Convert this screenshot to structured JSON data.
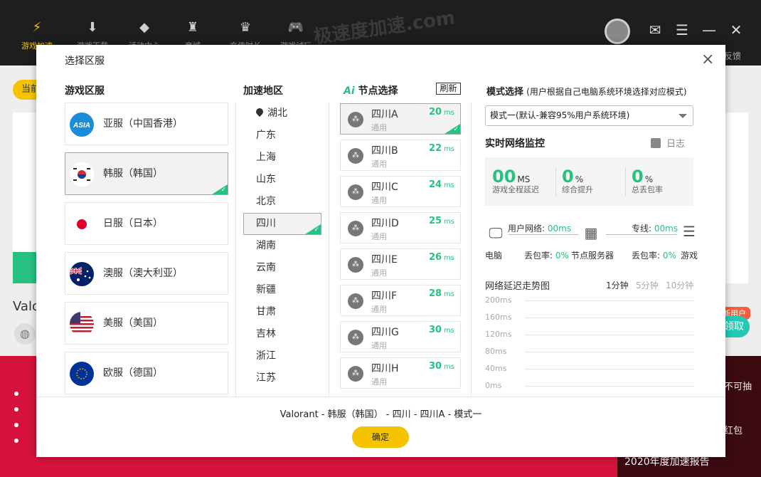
{
  "app": {
    "nav": [
      {
        "label": "游戏加速",
        "icon": "lightning-logo-icon"
      },
      {
        "label": "游戏下载",
        "icon": "download-icon"
      },
      {
        "label": "活动中心",
        "icon": "diamond-icon"
      },
      {
        "label": "商城",
        "icon": "castle-icon"
      },
      {
        "label": "充值时长",
        "icon": "crown-icon"
      },
      {
        "label": "游戏试玩",
        "icon": "gamepad-icon"
      }
    ],
    "watermark": "极速度加速.com",
    "feedback": "反馈",
    "current_chip": "当前",
    "game_title": "Valorant",
    "new_user_badge": "新用户",
    "claim_label": "领取",
    "banner_text1": "不可抽",
    "banner_text2": "红包",
    "banner_report": "2020年度加速报告"
  },
  "modal": {
    "title": "选择区服",
    "close": "×",
    "region_header": "游戏区服",
    "area_header": "加速地区",
    "node_header_ai": "Ai",
    "node_header": "节点选择",
    "refresh": "刷新",
    "regions": [
      {
        "label": "亚服（中国香港）",
        "flag": "asia",
        "selected": false
      },
      {
        "label": "韩服（韩国）",
        "flag": "korea",
        "selected": true
      },
      {
        "label": "日服（日本）",
        "flag": "japan",
        "selected": false
      },
      {
        "label": "澳服（澳大利亚）",
        "flag": "australia",
        "selected": false
      },
      {
        "label": "美服（美国）",
        "flag": "usa",
        "selected": false
      },
      {
        "label": "欧服（德国）",
        "flag": "eu",
        "selected": false
      }
    ],
    "areas": [
      {
        "label": "湖北",
        "pin": true,
        "selected": false
      },
      {
        "label": "广东",
        "selected": false
      },
      {
        "label": "上海",
        "selected": false
      },
      {
        "label": "山东",
        "selected": false
      },
      {
        "label": "北京",
        "selected": false
      },
      {
        "label": "四川",
        "selected": true
      },
      {
        "label": "湖南",
        "selected": false
      },
      {
        "label": "云南",
        "selected": false
      },
      {
        "label": "新疆",
        "selected": false
      },
      {
        "label": "甘肃",
        "selected": false
      },
      {
        "label": "吉林",
        "selected": false
      },
      {
        "label": "浙江",
        "selected": false
      },
      {
        "label": "江苏",
        "selected": false
      }
    ],
    "nodes": [
      {
        "name": "四川A",
        "sub": "通用",
        "ms": "20",
        "unit": "ms",
        "selected": true
      },
      {
        "name": "四川B",
        "sub": "通用",
        "ms": "22",
        "unit": "ms",
        "selected": false
      },
      {
        "name": "四川C",
        "sub": "通用",
        "ms": "24",
        "unit": "ms",
        "selected": false
      },
      {
        "name": "四川D",
        "sub": "通用",
        "ms": "25",
        "unit": "ms",
        "selected": false
      },
      {
        "name": "四川E",
        "sub": "通用",
        "ms": "26",
        "unit": "ms",
        "selected": false
      },
      {
        "name": "四川F",
        "sub": "通用",
        "ms": "28",
        "unit": "ms",
        "selected": false
      },
      {
        "name": "四川G",
        "sub": "通用",
        "ms": "30",
        "unit": "ms",
        "selected": false
      },
      {
        "name": "四川H",
        "sub": "通用",
        "ms": "30",
        "unit": "ms",
        "selected": false
      }
    ],
    "mode_title": "模式选择",
    "mode_hint": "(用户根据自己电脑系统环境选择对应模式)",
    "mode_selected": "模式一(默认-兼容95%用户系统环境)",
    "monitor_title": "实时网络监控",
    "log_label": "日志",
    "stats": [
      {
        "value": "00",
        "unit": "MS",
        "label": "游戏全程延迟"
      },
      {
        "value": "0",
        "unit": "%",
        "label": "综合提升"
      },
      {
        "value": "0",
        "unit": "%",
        "label": "总丢包率"
      }
    ],
    "topology": {
      "user_net_label": "用户网络:",
      "user_net_value": "00ms",
      "dedicated_label": "专线:",
      "dedicated_value": "00ms",
      "loss1_label": "丢包率:",
      "loss1_value": "0%",
      "loss2_label": "丢包率:",
      "loss2_value": "0%",
      "pc_label": "电脑",
      "server_label": "节点服务器",
      "game_label": "游戏"
    },
    "trend_title": "网络延迟走势图",
    "trend_tabs": [
      {
        "label": "1分钟",
        "active": true
      },
      {
        "label": "5分钟",
        "active": false
      },
      {
        "label": "10分钟",
        "active": false
      }
    ],
    "y_ticks": [
      "200ms",
      "160ms",
      "120ms",
      "80ms",
      "40ms",
      "0ms"
    ],
    "summary": "Valorant - 韩服（韩国） - 四川 - 四川A - 模式一",
    "confirm": "确定"
  },
  "colors": {
    "accent": "#f5c400",
    "green": "#27c281",
    "banner_red": "#d5123b"
  }
}
